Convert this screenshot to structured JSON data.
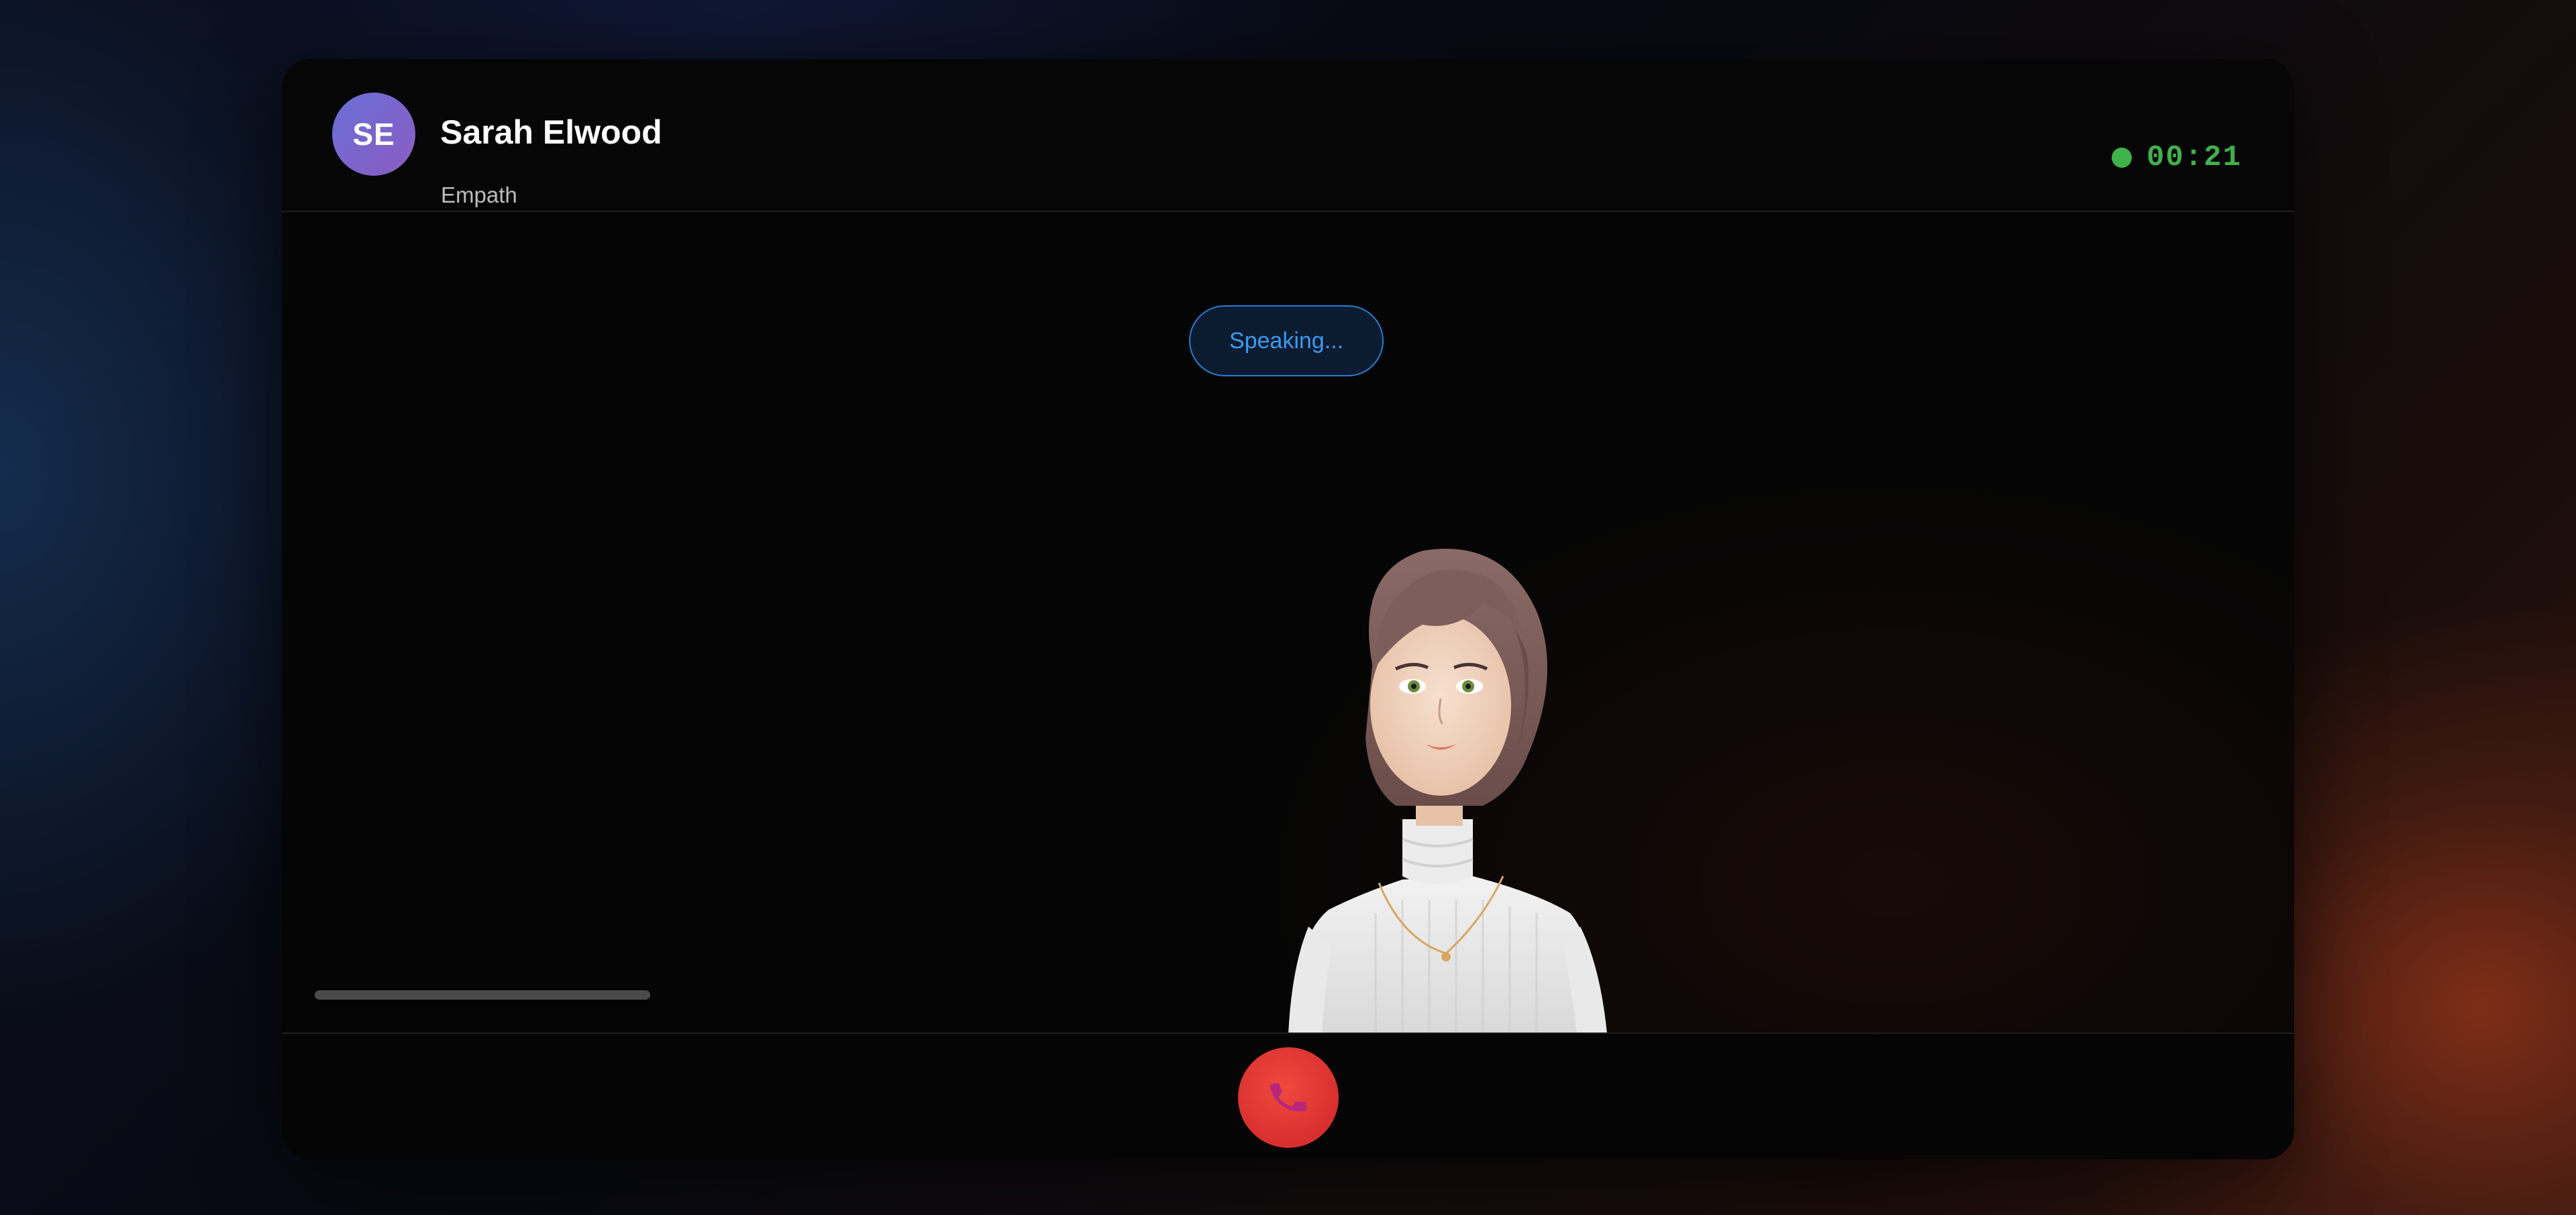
{
  "call": {
    "caller_initials": "SE",
    "caller_name": "Sarah Elwood",
    "caller_role": "Empath",
    "timer": "00:21",
    "status_text": "Speaking...",
    "status_dot_color": "#3fb24a",
    "accent_color": "#2a7bd0",
    "hangup_color": "#e63b35",
    "audio_progress": 0.0
  },
  "icons": {
    "hangup": "phone-hangup-icon"
  }
}
